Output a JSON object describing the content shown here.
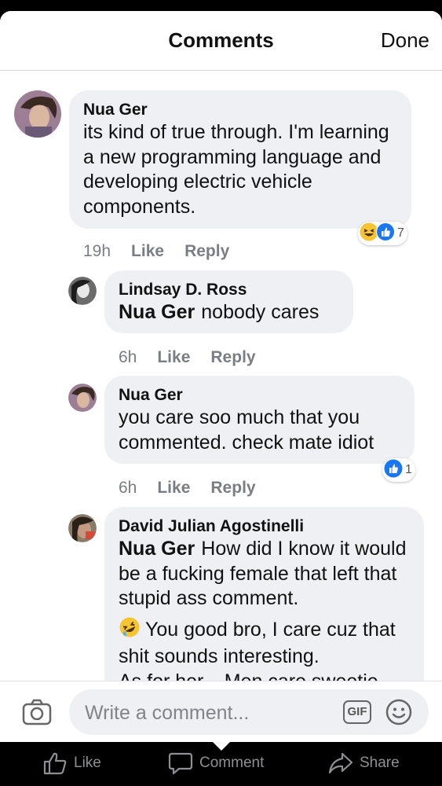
{
  "header": {
    "title": "Comments",
    "done_label": "Done"
  },
  "comments": [
    {
      "author": "Nua Ger",
      "text": "its kind of true through. I'm learning a new programming language and developing electric vehicle components.",
      "time": "19h",
      "like": "Like",
      "reply": "Reply",
      "reactions": {
        "icons": [
          "laugh-reaction-icon",
          "like-reaction-icon"
        ],
        "count": "7"
      }
    },
    {
      "author": "Lindsay D. Ross",
      "mention": "Nua Ger",
      "text": "nobody cares",
      "time": "6h",
      "like": "Like",
      "reply": "Reply"
    },
    {
      "author": "Nua Ger",
      "text": "you care soo much that you commented. check mate idiot",
      "time": "6h",
      "like": "Like",
      "reply": "Reply",
      "reactions": {
        "icons": [
          "like-reaction-icon"
        ],
        "count": "1"
      }
    },
    {
      "author": "David Julian Agostinelli",
      "mention": "Nua Ger",
      "text": "How did I know it would be a fucking female that left that stupid ass comment.",
      "text2": "You good bro, I care cuz that shit sounds interesting.",
      "text3": "As for her... Men care sweetie"
    }
  ],
  "composer": {
    "placeholder": "Write a comment...",
    "gif_label": "GIF"
  },
  "tabbar": {
    "like": "Like",
    "comment": "Comment",
    "share": "Share"
  },
  "colors": {
    "bubble": "#eff0f3",
    "like_blue": "#1877f2",
    "laugh_yellow": "#f7c434",
    "meta_gray": "#7a7d83"
  }
}
